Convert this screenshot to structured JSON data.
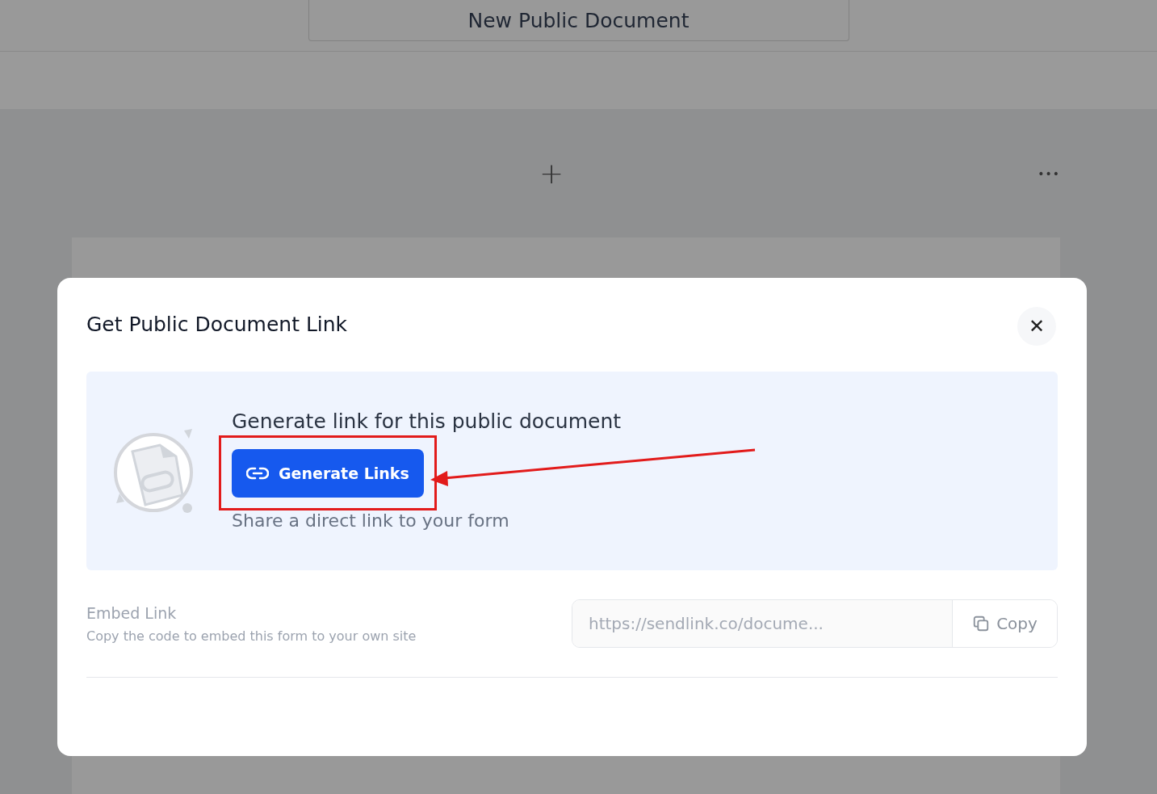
{
  "header": {
    "document_title": "New Public Document"
  },
  "toolbar": {
    "add_label": "+",
    "more_label": "•••"
  },
  "dialog": {
    "title": "Get Public Document Link",
    "close_label": "✕",
    "generate": {
      "heading": "Generate link for this public document",
      "button": "Generate Links",
      "description": "Share a direct link to your form"
    },
    "embed": {
      "label": "Embed Link",
      "description": "Copy the code to embed this form to your own site",
      "placeholder": "https://sendlink.co/docume...",
      "copy_button": "Copy"
    }
  },
  "annotations": {
    "highlight_box": true,
    "pointer_arrow": true
  }
}
